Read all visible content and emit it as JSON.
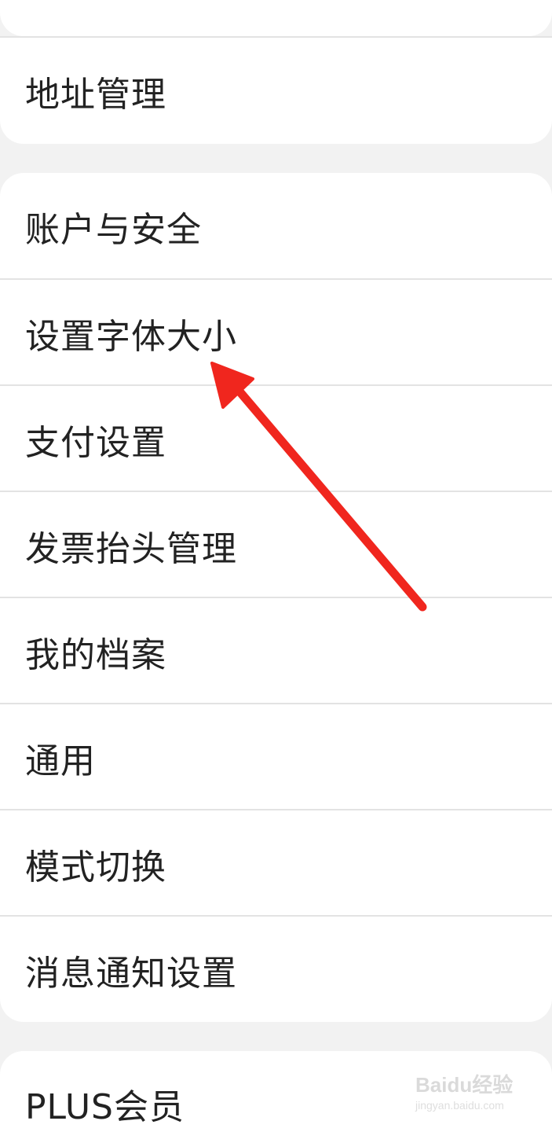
{
  "settings_list": {
    "group1": {
      "items": [
        {
          "label": "地址管理"
        }
      ]
    },
    "group2": {
      "items": [
        {
          "label": "账户与安全"
        },
        {
          "label": "设置字体大小"
        },
        {
          "label": "支付设置"
        },
        {
          "label": "发票抬头管理"
        },
        {
          "label": "我的档案"
        },
        {
          "label": "通用"
        },
        {
          "label": "模式切换"
        },
        {
          "label": "消息通知设置"
        }
      ]
    },
    "group3": {
      "items": [
        {
          "label": "PLUS会员"
        }
      ]
    }
  },
  "annotation": {
    "arrow_color": "#f0261e",
    "arrow_target": "设置字体大小"
  },
  "watermark": {
    "brand": "Baidu经验",
    "url": "jingyan.baidu.com"
  },
  "colors": {
    "background": "#f2f2f2",
    "card": "#ffffff",
    "text": "#222222",
    "divider": "#e3e3e3"
  }
}
